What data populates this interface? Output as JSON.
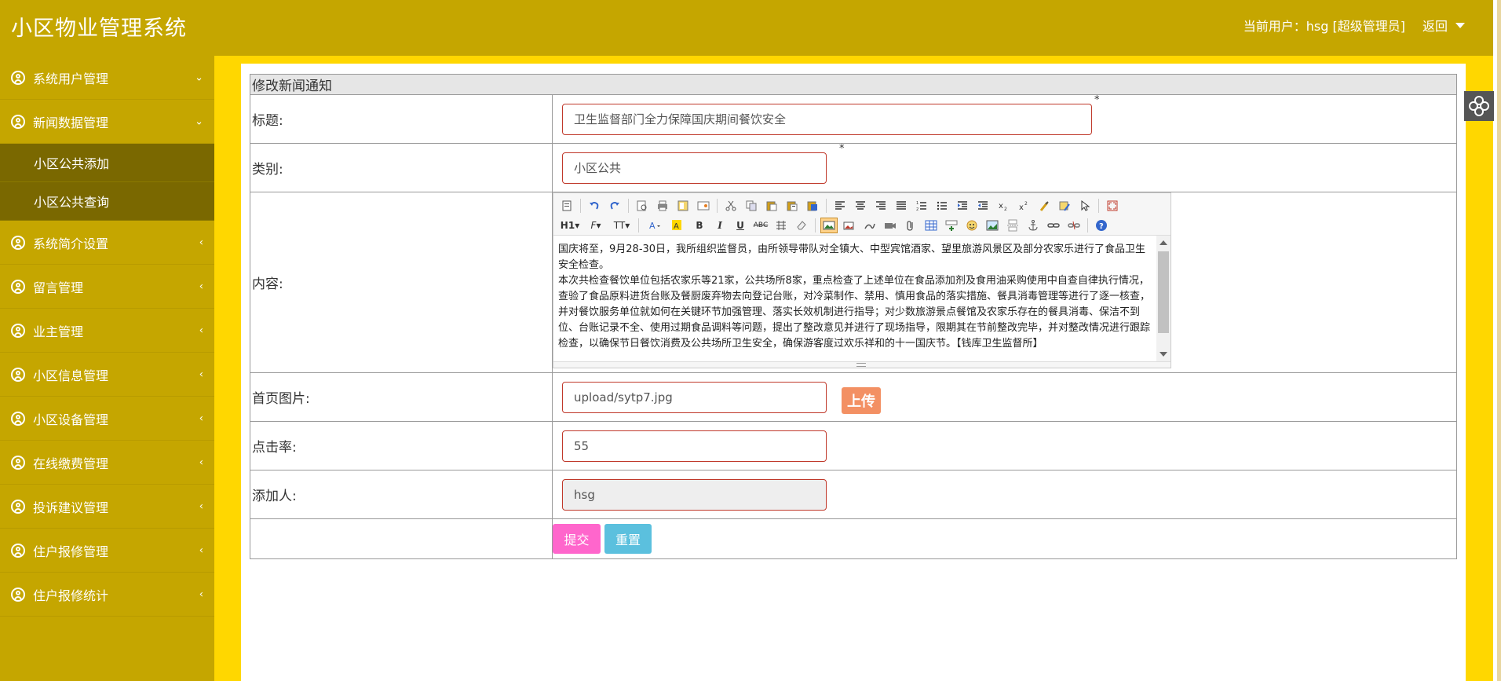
{
  "header": {
    "app_title": "小区物业管理系统",
    "current_user": "当前用户：hsg [超级管理员]",
    "back_label": "返回"
  },
  "sidebar": {
    "items": [
      {
        "label": "系统用户管理",
        "arrow": "down"
      },
      {
        "label": "新闻数据管理",
        "arrow": "down",
        "expanded": true,
        "children": [
          {
            "label": "小区公共添加"
          },
          {
            "label": "小区公共查询"
          }
        ]
      },
      {
        "label": "系统简介设置",
        "arrow": "left"
      },
      {
        "label": "留言管理",
        "arrow": "left"
      },
      {
        "label": "业主管理",
        "arrow": "left"
      },
      {
        "label": "小区信息管理",
        "arrow": "left"
      },
      {
        "label": "小区设备管理",
        "arrow": "left"
      },
      {
        "label": "在线缴费管理",
        "arrow": "left"
      },
      {
        "label": "投诉建议管理",
        "arrow": "left"
      },
      {
        "label": "住户报修管理",
        "arrow": "left"
      },
      {
        "label": "住户报修统计",
        "arrow": "left"
      }
    ]
  },
  "form": {
    "title": "修改新闻通知",
    "fields": {
      "title": {
        "label": "标题:",
        "value": "卫生监督部门全力保障国庆期间餐饮安全",
        "required_mark": "*"
      },
      "category": {
        "label": "类别:",
        "value": "小区公共",
        "required_mark": "*"
      },
      "content": {
        "label": "内容:",
        "text_lines": [
          "国庆将至，9月28-30日，我所组织监督员，由所领导带队对全镇大、中型宾馆酒家、望里旅游风景区及部分农家乐进行了食品卫生安全检查。",
          "本次共检查餐饮单位包括农家乐等21家，公共场所8家，重点检查了上述单位在食品添加剂及食用油采购使用中自查自律执行情况，查验了食品原料进货台账及餐厨废弃物去向登记台账，对冷菜制作、禁用、慎用食品的落实措施、餐具消毒管理等进行了逐一核查，并对餐饮服务单位就如何在关键环节加强管理、落实长效机制进行指导；对少数旅游景点餐馆及农家乐存在的餐具消毒、保洁不到位、台账记录不全、使用过期食品调料等问题，提出了整改意见并进行了现场指导，限期其在节前整改完毕，并对整改情况进行跟踪检查，以确保节日餐饮消费及公共场所卫生安全，确保游客度过欢乐祥和的十一国庆节。【钱库卫生监督所】"
        ]
      },
      "image": {
        "label": "首页图片:",
        "value": "upload/sytp7.jpg",
        "upload_label": "上传"
      },
      "clicks": {
        "label": "点击率:",
        "value": "55"
      },
      "author": {
        "label": "添加人:",
        "value": "hsg"
      }
    },
    "submit_label": "提交",
    "reset_label": "重置"
  },
  "editor_toolbar": {
    "heading_label": "H1",
    "font_label": "F",
    "size_label": "TT",
    "bold": "B",
    "italic": "I",
    "underline": "U",
    "strike": "ABC"
  },
  "colors": {
    "sidebar": "#c5a600",
    "sidebar_active": "#7a6800",
    "main_bg": "#ffd700",
    "submit": "#ff66cc",
    "reset": "#5bc0de",
    "upload": "#f39063",
    "input_border": "#c0392b"
  }
}
